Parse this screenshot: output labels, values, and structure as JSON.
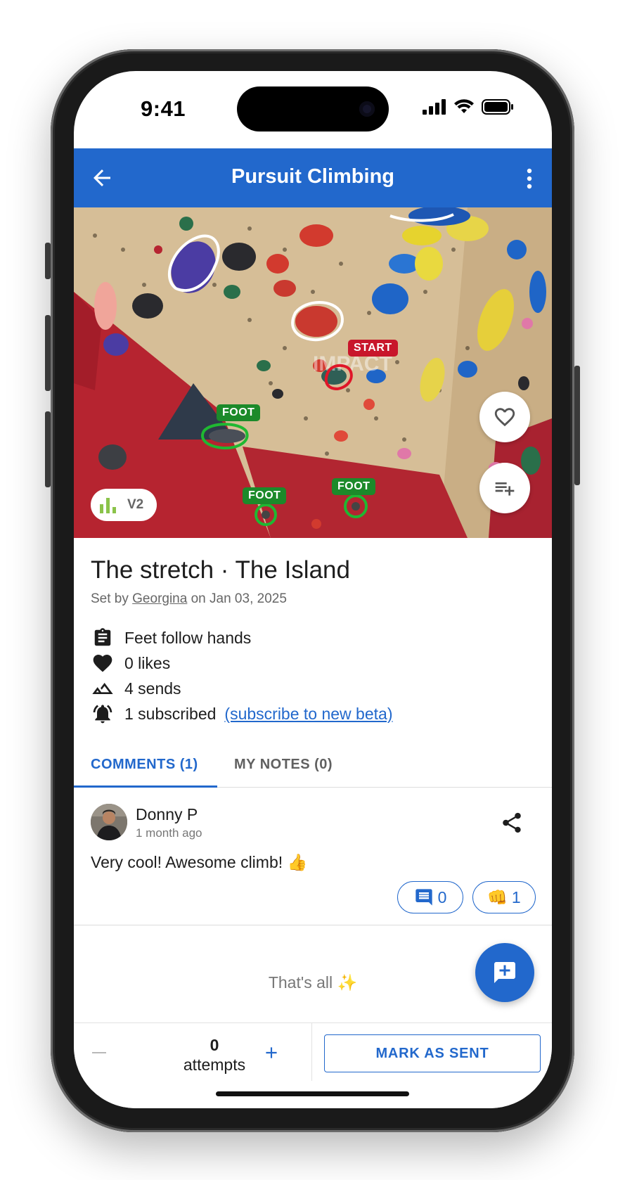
{
  "status_bar": {
    "time": "9:41"
  },
  "app_bar": {
    "title": "Pursuit Climbing"
  },
  "photo": {
    "wall_logo": "IMPACT",
    "tags": {
      "start": "START",
      "foot_1": "FOOT",
      "foot_2": "FOOT",
      "foot_3": "FOOT"
    },
    "grade": "V2"
  },
  "climb": {
    "title": "The stretch · The Island",
    "set_by_prefix": "Set by",
    "setter": "Georgina",
    "set_on": "on Jan 03, 2025",
    "facts": {
      "rule": "Feet follow hands",
      "likes": "0 likes",
      "sends": "4 sends",
      "subscribed": "1 subscribed",
      "subscribe_link": "(subscribe to new beta)"
    }
  },
  "tabs": {
    "comments": "COMMENTS (1)",
    "notes": "MY NOTES (0)"
  },
  "comment": {
    "author": "Donny P",
    "time_ago": "1 month ago",
    "text": "Very cool! Awesome climb! 👍",
    "replies_count": "0",
    "fist_emoji": "👊",
    "fist_count": "1"
  },
  "feed_end": "That's all ✨",
  "bottom_bar": {
    "attempts_count": "0",
    "attempts_label": "attempts",
    "mark_sent": "MARK AS SENT"
  },
  "colors": {
    "primary": "#2268cc",
    "start_tag": "#c8162b",
    "foot_tag": "#1c8a2a"
  },
  "icons": [
    "back-arrow-icon",
    "more-vert-icon",
    "heart-outline-icon",
    "playlist-add-icon",
    "bar-chart-icon",
    "clipboard-icon",
    "heart-filled-icon",
    "mountain-icon",
    "bell-ring-icon",
    "share-icon",
    "comment-icon",
    "add-comment-icon",
    "minus-icon",
    "plus-icon"
  ]
}
